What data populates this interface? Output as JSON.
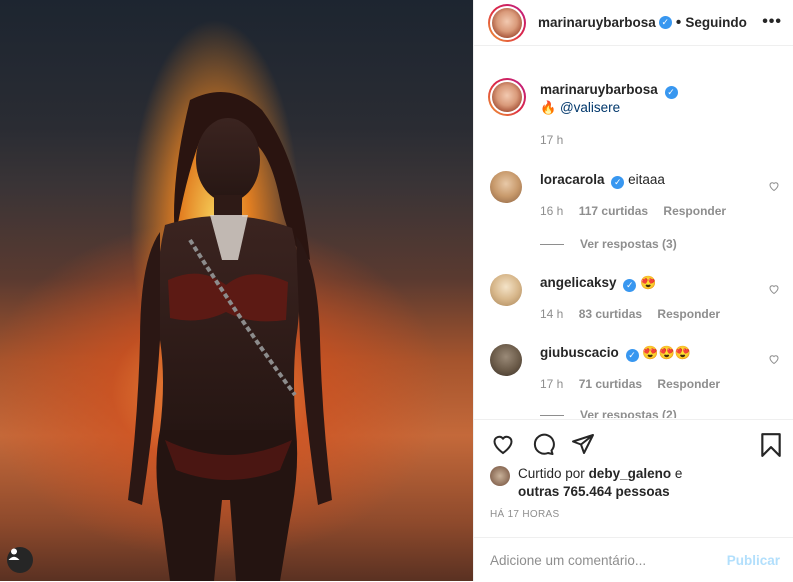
{
  "post": {
    "author": "marinaruybarbosa",
    "separator": "•",
    "follow_status": "Seguindo",
    "more_icon": "more-horizontal-icon"
  },
  "caption": {
    "username": "marinaruybarbosa",
    "emoji": "🔥",
    "mention": "@valisere",
    "time": "17 h"
  },
  "comments": [
    {
      "username": "loracarola",
      "text": "eitaaa",
      "time": "16 h",
      "likes": "117 curtidas",
      "reply": "Responder",
      "view_replies": "Ver respostas (3)"
    },
    {
      "username": "angelicaksy",
      "text": "😍",
      "time": "14 h",
      "likes": "83 curtidas",
      "reply": "Responder"
    },
    {
      "username": "giubuscacio",
      "text": "😍😍😍",
      "time": "17 h",
      "likes": "71 curtidas",
      "reply": "Responder",
      "view_replies": "Ver respostas (2)"
    }
  ],
  "likes_summary": {
    "prefix": "Curtido por",
    "user": "deby_galeno",
    "and": "e",
    "others": "outras 765.464 pessoas"
  },
  "timestamp": "HÁ 17 HORAS",
  "composer": {
    "placeholder": "Adicione um comentário...",
    "post_label": "Publicar"
  },
  "colors": {
    "verified": "#3897f0",
    "link": "#00376b",
    "muted": "#8e8e8e",
    "post_disabled": "#b2dffc"
  }
}
